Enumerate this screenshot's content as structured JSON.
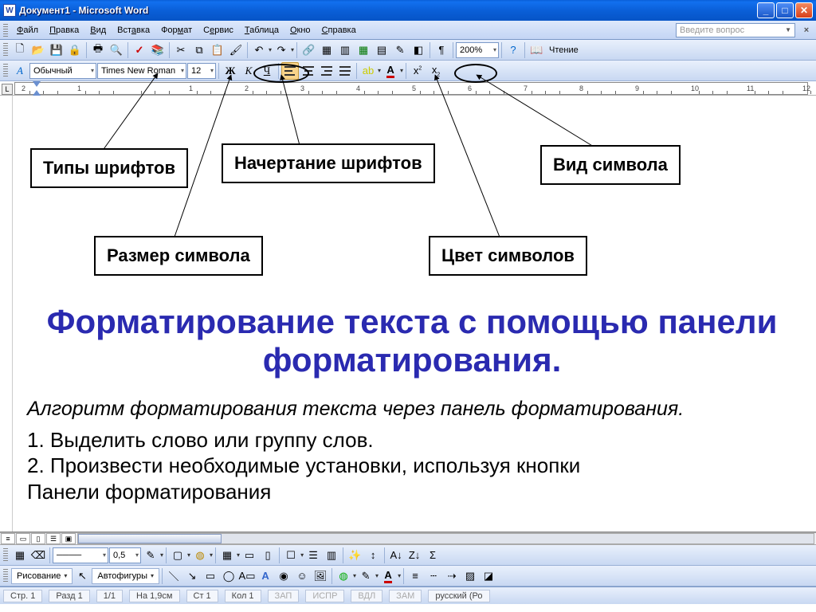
{
  "titlebar": {
    "title": "Документ1 - Microsoft Word"
  },
  "menus": {
    "file": "Файл",
    "edit": "Правка",
    "view": "Вид",
    "insert": "Вставка",
    "format": "Формат",
    "service": "Сервис",
    "table": "Таблица",
    "window": "Окно",
    "help": "Справка"
  },
  "question_box": {
    "placeholder": "Введите вопрос"
  },
  "standard_toolbar": {
    "zoom": "200%",
    "reading": "Чтение"
  },
  "formatting_toolbar": {
    "styles_label": "A",
    "style": "Обычный",
    "font": "Times New Roman",
    "size": "12",
    "bold": "Ж",
    "italic": "К",
    "underline": "Ч",
    "super": "x²",
    "sub": "x₂"
  },
  "ruler": {
    "numbers": [
      "2",
      "1",
      "",
      "1",
      "2",
      "3",
      "4",
      "5",
      "6",
      "7",
      "8",
      "9",
      "10",
      "11",
      "12"
    ]
  },
  "callouts": {
    "types": "Типы шрифтов",
    "style": "Начертание шрифтов",
    "symbol_kind": "Вид символа",
    "size": "Размер символа",
    "color": "Цвет символов"
  },
  "document": {
    "headline": "Форматирование текста с помощью панели форматирования.",
    "subhead": "Алгоритм форматирования текста через панель форматирования.",
    "line1": "1. Выделить слово или группу слов.",
    "line2": "2. Произвести необходимые установки, используя кнопки",
    "line3": "Панели форматирования"
  },
  "drawing_toolbar": {
    "label": "Рисование",
    "autoshapes": "Автофигуры"
  },
  "tables_toolbar": {
    "border_width": "0,5"
  },
  "status": {
    "page": "Стр. 1",
    "section": "Разд 1",
    "pages": "1/1",
    "at": "На 1,9см",
    "line": "Ст 1",
    "col": "Кол 1",
    "rec": "ЗАП",
    "trk": "ИСПР",
    "ext": "ВДЛ",
    "ovr": "ЗАМ",
    "lang": "русский (Ро"
  }
}
